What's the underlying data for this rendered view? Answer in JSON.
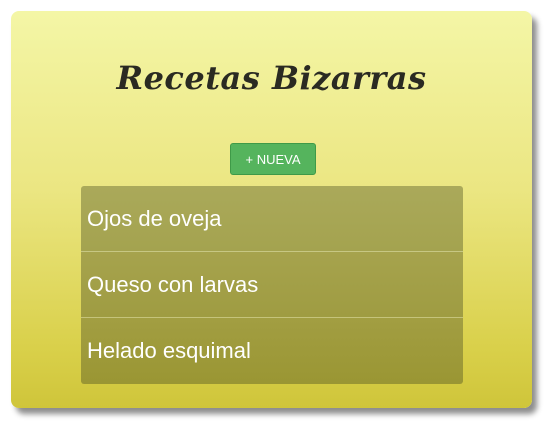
{
  "app": {
    "title": "Recetas Bizarras"
  },
  "toolbar": {
    "new_label": "+ NUEVA"
  },
  "recipes": [
    {
      "name": "Ojos de oveja"
    },
    {
      "name": "Queso con larvas"
    },
    {
      "name": "Helado esquimal"
    }
  ],
  "colors": {
    "card_top": "#f4f6a6",
    "card_bottom": "#cfc53a",
    "button": "#55b45d",
    "list_item": "#a4a34f"
  }
}
